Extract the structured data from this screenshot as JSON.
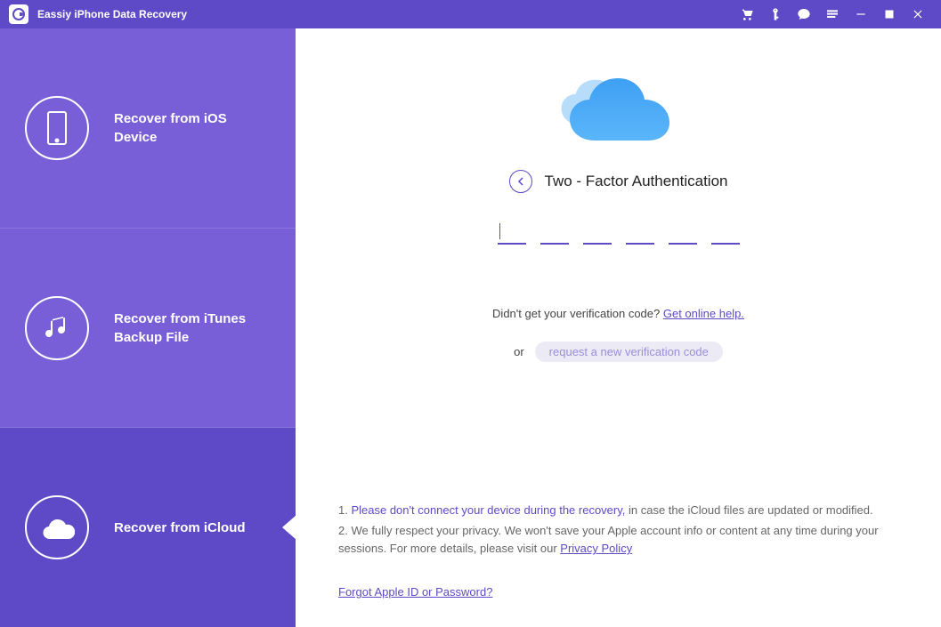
{
  "titlebar": {
    "app_title": "Eassiy iPhone Data Recovery"
  },
  "sidebar": {
    "items": [
      {
        "label": "Recover from iOS\nDevice"
      },
      {
        "label": "Recover from iTunes\nBackup File"
      },
      {
        "label": "Recover from iCloud"
      }
    ]
  },
  "main": {
    "heading": "Two - Factor Authentication",
    "help_text_prefix": "Didn't get your verification code? ",
    "help_link": "Get online help.",
    "or_label": "or",
    "request_button": "request a new verification code",
    "note1_prefix": "1. ",
    "note1_highlight": "Please don't connect your device during the recovery,",
    "note1_suffix": " in case the iCloud files are updated or modified.",
    "note2_prefix": "2. We fully respect your privacy. We won't save your Apple account info or content at any time during your sessions. For more details, please visit our ",
    "note2_link": "Privacy Policy",
    "forgot_link": "Forgot Apple ID or Password?"
  }
}
